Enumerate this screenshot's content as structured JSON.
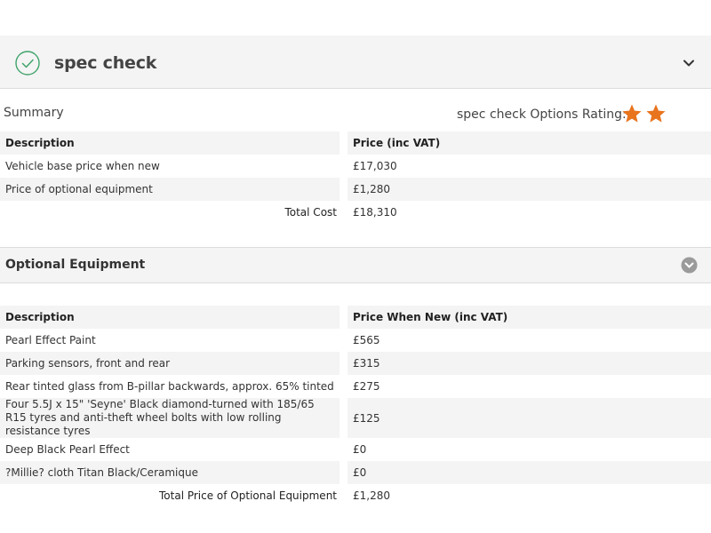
{
  "header": {
    "title": "spec check",
    "check_icon": "check-circle-icon",
    "chevron_icon": "chevron-down-icon",
    "accent": "#3fa36b"
  },
  "summary": {
    "label": "Summary",
    "rating_label": "spec check Options Rating:",
    "rating_value": 2.5,
    "rating_max": 3,
    "star_color": "#e8741e",
    "table": {
      "headers": [
        "Description",
        "Price (inc VAT)"
      ],
      "rows": [
        [
          "Vehicle base price when new",
          "£17,030"
        ],
        [
          "Price of optional equipment",
          "£1,280"
        ]
      ],
      "total_label": "Total Cost",
      "total_value": "£18,310"
    }
  },
  "optional_equipment": {
    "title": "Optional Equipment",
    "toggle_icon": "chevron-down-circle-icon",
    "table": {
      "headers": [
        "Description",
        "Price When New (inc VAT)"
      ],
      "rows": [
        [
          "Pearl Effect Paint",
          "£565"
        ],
        [
          "Parking sensors, front and rear",
          "£315"
        ],
        [
          "Rear tinted glass from B-pillar backwards, approx. 65% tinted",
          "£275"
        ],
        [
          "Four 5.5J x 15\" 'Seyne' Black diamond-turned with 185/65 R15 tyres and anti-theft wheel bolts with low rolling resistance tyres",
          "£125"
        ],
        [
          "Deep Black Pearl Effect",
          "£0"
        ],
        [
          "?Millie? cloth Titan Black/Ceramique",
          "£0"
        ]
      ],
      "total_label": "Total Price of Optional Equipment",
      "total_value": "£1,280"
    }
  }
}
